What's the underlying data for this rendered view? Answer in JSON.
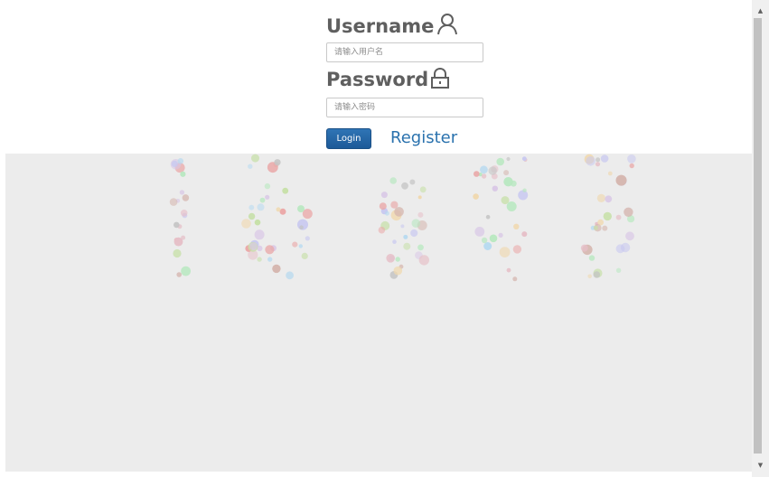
{
  "form": {
    "username_label": "Username",
    "username_placeholder": "请输入用户名",
    "password_label": "Password",
    "password_placeholder": "请输入密码",
    "login_label": "Login",
    "register_label": "Register"
  },
  "icons": {
    "user": "user-icon",
    "lock": "lock-icon",
    "scroll_up": "scroll-up-arrow",
    "scroll_down": "scroll-down-arrow"
  },
  "colors": {
    "label_text": "#5f5f5f",
    "login_button": "#2966a6",
    "register_link": "#2a72ae",
    "background_panel": "#ececec",
    "dot_palette": [
      "#c7e0a8",
      "#c4c4c4",
      "#e6c0c8",
      "#b5d9f0",
      "#d6b7b0",
      "#eaa7a7",
      "#c9c9f0",
      "#b8e8c0",
      "#f0d9b0",
      "#d9c8e6"
    ]
  }
}
